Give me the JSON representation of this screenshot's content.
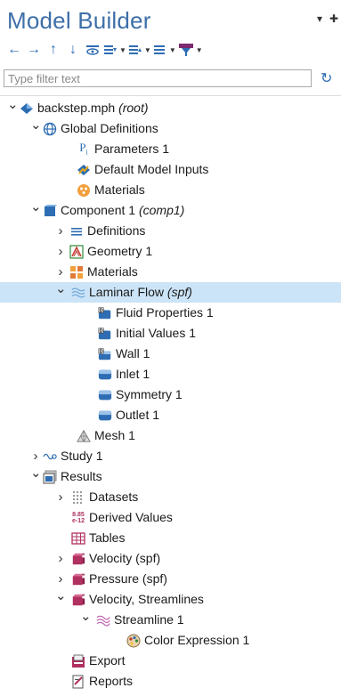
{
  "header": {
    "title": "Model Builder",
    "pin_icon": "pin-icon",
    "menu_icon": "chevron-down-icon"
  },
  "toolbar": {
    "buttons": [
      {
        "name": "back-icon",
        "glyph": "←"
      },
      {
        "name": "forward-icon",
        "glyph": "→"
      },
      {
        "name": "move-up-icon",
        "glyph": "↑"
      },
      {
        "name": "move-down-icon",
        "glyph": "↓"
      },
      {
        "name": "show-icon",
        "glyph": "👁"
      },
      {
        "name": "expand-icon",
        "glyph": "☰"
      },
      {
        "name": "collapse-icon",
        "glyph": "☰"
      },
      {
        "name": "list-icon",
        "glyph": "☰"
      },
      {
        "name": "funnel-icon",
        "glyph": "▼"
      }
    ]
  },
  "filter": {
    "placeholder": "Type filter text",
    "value": ""
  },
  "tree": [
    {
      "label": "backstep.mph",
      "tag": "(root)",
      "icon": "model-icon",
      "expander": "open"
    },
    {
      "label": "Global Definitions",
      "tag": "",
      "icon": "globe-icon",
      "expander": "open"
    },
    {
      "label": "Parameters 1",
      "tag": "",
      "icon": "parameters-icon",
      "expander": "none"
    },
    {
      "label": "Default Model Inputs",
      "tag": "",
      "icon": "model-inputs-icon",
      "expander": "none"
    },
    {
      "label": "Materials",
      "tag": "",
      "icon": "materials-icon",
      "expander": "none"
    },
    {
      "label": "Component 1",
      "tag": "(comp1)",
      "icon": "component-icon",
      "expander": "open"
    },
    {
      "label": "Definitions",
      "tag": "",
      "icon": "definitions-icon",
      "expander": "closed"
    },
    {
      "label": "Geometry 1",
      "tag": "",
      "icon": "geometry-icon",
      "expander": "closed"
    },
    {
      "label": "Materials",
      "tag": "",
      "icon": "materials-grid-icon",
      "expander": "closed"
    },
    {
      "label": "Laminar Flow",
      "tag": "(spf)",
      "icon": "laminar-flow-icon",
      "expander": "open",
      "selected": true
    },
    {
      "label": "Fluid Properties 1",
      "tag": "",
      "icon": "domain-feature-icon",
      "expander": "none"
    },
    {
      "label": "Initial Values 1",
      "tag": "",
      "icon": "domain-feature-icon",
      "expander": "none"
    },
    {
      "label": "Wall 1",
      "tag": "",
      "icon": "boundary-feature-icon",
      "expander": "none"
    },
    {
      "label": "Inlet 1",
      "tag": "",
      "icon": "boundary-icon",
      "expander": "none"
    },
    {
      "label": "Symmetry 1",
      "tag": "",
      "icon": "boundary-icon",
      "expander": "none"
    },
    {
      "label": "Outlet 1",
      "tag": "",
      "icon": "boundary-icon",
      "expander": "none"
    },
    {
      "label": "Mesh 1",
      "tag": "",
      "icon": "mesh-icon",
      "expander": "none"
    },
    {
      "label": "Study 1",
      "tag": "",
      "icon": "study-icon",
      "expander": "closed"
    },
    {
      "label": "Results",
      "tag": "",
      "icon": "results-icon",
      "expander": "open"
    },
    {
      "label": "Datasets",
      "tag": "",
      "icon": "datasets-icon",
      "expander": "closed"
    },
    {
      "label": "Derived Values",
      "tag": "",
      "icon": "derived-values-icon",
      "expander": "none",
      "icon_text_top": "8.85",
      "icon_text_bottom": "e-12"
    },
    {
      "label": "Tables",
      "tag": "",
      "icon": "table-icon",
      "expander": "none"
    },
    {
      "label": "Velocity (spf)",
      "tag": "",
      "icon": "plot-group-icon",
      "expander": "closed"
    },
    {
      "label": "Pressure (spf)",
      "tag": "",
      "icon": "plot-group-icon",
      "expander": "closed"
    },
    {
      "label": "Velocity, Streamlines",
      "tag": "",
      "icon": "plot-group-icon",
      "expander": "open"
    },
    {
      "label": "Streamline 1",
      "tag": "",
      "icon": "streamline-icon",
      "expander": "open"
    },
    {
      "label": "Color Expression 1",
      "tag": "",
      "icon": "color-expression-icon",
      "expander": "none"
    },
    {
      "label": "Export",
      "tag": "",
      "icon": "export-icon",
      "expander": "none"
    },
    {
      "label": "Reports",
      "tag": "",
      "icon": "reports-icon",
      "expander": "none"
    }
  ]
}
